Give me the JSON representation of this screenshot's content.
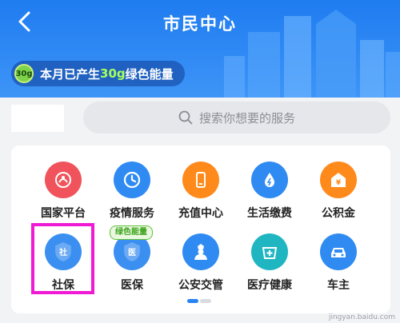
{
  "header": {
    "title": "市民中心"
  },
  "energy_banner": {
    "badge": "30g",
    "prefix": "本月已产生",
    "amount": "30g",
    "suffix": "绿色能量"
  },
  "search": {
    "placeholder": "搜索你想要的服务"
  },
  "services": [
    {
      "label": "国家平台",
      "icon": "national-platform-icon",
      "color": "#f0535b"
    },
    {
      "label": "疫情服务",
      "icon": "clock-icon",
      "color": "#2f8bf2"
    },
    {
      "label": "充值中心",
      "icon": "phone-icon",
      "color": "#ff8a1c"
    },
    {
      "label": "生活缴费",
      "icon": "water-drop-icon",
      "color": "#2f8bf2"
    },
    {
      "label": "公积金",
      "icon": "yuan-house-icon",
      "color": "#ff8a1c"
    },
    {
      "label": "社保",
      "icon": "social-security-shield-icon",
      "color": "#3a8ff0",
      "glyph": "社"
    },
    {
      "label": "医保",
      "icon": "medical-insurance-shield-icon",
      "color": "#3a8ff0",
      "glyph": "医",
      "tag": "绿色能量"
    },
    {
      "label": "公安交管",
      "icon": "police-icon",
      "color": "#2f8bf2"
    },
    {
      "label": "医疗健康",
      "icon": "health-cross-icon",
      "color": "#1fb6c2"
    },
    {
      "label": "车主",
      "icon": "car-icon",
      "color": "#2f8bf2"
    }
  ],
  "watermark": "jingyan.baidu.com"
}
